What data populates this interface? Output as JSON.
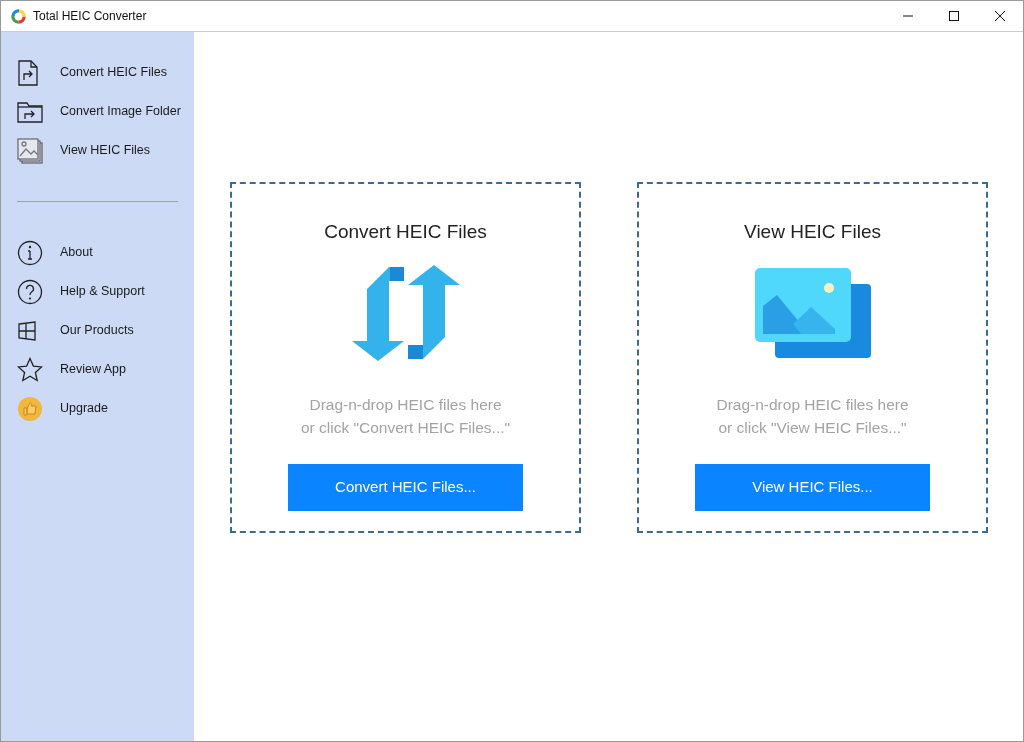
{
  "window": {
    "title": "Total HEIC Converter"
  },
  "sidebar": {
    "top_items": [
      {
        "label": "Convert HEIC Files",
        "kind": "file"
      },
      {
        "label": "Convert Image Folder",
        "kind": "folder"
      },
      {
        "label": "View HEIC Files",
        "kind": "images"
      }
    ],
    "bottom_items": [
      {
        "label": "About",
        "kind": "info"
      },
      {
        "label": "Help & Support",
        "kind": "help"
      },
      {
        "label": "Our Products",
        "kind": "grid"
      },
      {
        "label": "Review App",
        "kind": "star"
      },
      {
        "label": "Upgrade",
        "kind": "upgrade"
      }
    ]
  },
  "cards": [
    {
      "kind": "convert",
      "title": "Convert HEIC Files",
      "hint_lines": [
        "Drag-n-drop HEIC files here",
        "or click \"Convert HEIC Files...\""
      ],
      "button": "Convert HEIC Files..."
    },
    {
      "kind": "view",
      "title": "View HEIC Files",
      "hint_lines": [
        "Drag-n-drop HEIC files here",
        "or click \"View HEIC Files...\""
      ],
      "button": "View HEIC Files..."
    }
  ]
}
